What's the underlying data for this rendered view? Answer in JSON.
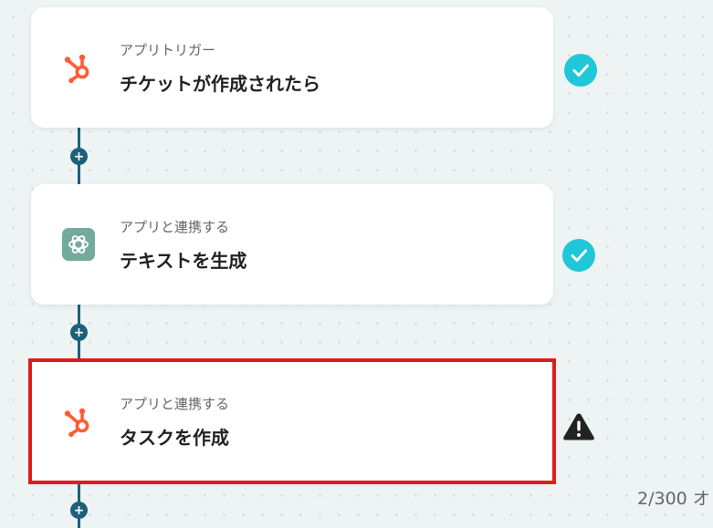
{
  "steps": [
    {
      "subtitle": "アプリトリガー",
      "title": "チケットが作成されたら",
      "app_icon": "hubspot-icon",
      "status": "check-icon"
    },
    {
      "subtitle": "アプリと連携する",
      "title": "テキストを生成",
      "app_icon": "chatgpt-icon",
      "status": "check-icon"
    },
    {
      "subtitle": "アプリと連携する",
      "title": "タスクを作成",
      "app_icon": "hubspot-icon",
      "status": "warning-icon",
      "selected": true
    }
  ],
  "add_step_label": "+",
  "footer": {
    "operation_count": "2/300 オ"
  },
  "colors": {
    "connector": "#1d5f7a",
    "check": "#1fc7d9",
    "hubspot": "#ff5c35",
    "chatgpt": "#74aa9c",
    "selected_border": "#dc1e1e",
    "warning": "#222222"
  }
}
